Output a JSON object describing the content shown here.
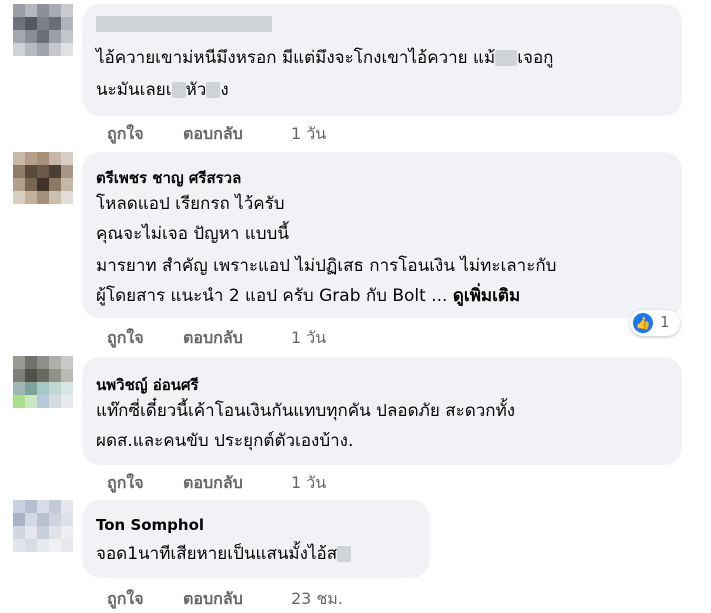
{
  "comments": [
    {
      "author": "",
      "lines": [
        "ไอ้ควายเขาม่หนีมึงหรอก มีแต่มึงจะโกงเขาไอ้ควาย แม้",
        "นะมันเลยเ"
      ],
      "line_tails": [
        "เจอกู",
        "หัว",
        "ง"
      ],
      "actions": {
        "like": "ถูกใจ",
        "reply": "ตอบกลับ",
        "time": "1 วัน"
      }
    },
    {
      "author": "ตรีเพชร ชาญ ศรีสรวล",
      "lines": [
        "โหลดแอป เรียกรถ ไว้ครับ",
        "คุณจะไม่เจอ ปัญหา แบบนี้",
        "มารยาท สำคัญ เพราะแอป ไม่ปฏิเสธ การโอนเงิน ไม่ทะเลาะกับ",
        "ผู้โดยสาร แนะนำ 2 แอป ครับ Grab กับ Bolt ..."
      ],
      "see_more": "ดูเพิ่มเติม",
      "reaction_count": "1",
      "actions": {
        "like": "ถูกใจ",
        "reply": "ตอบกลับ",
        "time": "1 วัน"
      }
    },
    {
      "author": "นพวิชญ์ อ่อนศรี",
      "lines": [
        "แท๊กซี่เดี๋ยวนี้เค้าโอนเงินกันแทบทุกคัน ปลอดภัย สะดวกทั้ง",
        "ผดส.และคนขับ ประยุกต์ตัวเองบ้าง."
      ],
      "actions": {
        "like": "ถูกใจ",
        "reply": "ตอบกลับ",
        "time": "1 วัน"
      }
    },
    {
      "author": "Ton Somphol",
      "lines": [
        "จอด1นาทีเสียหายเป็นแสนมั้งไอ้ส"
      ],
      "actions": {
        "like": "ถูกใจ",
        "reply": "ตอบกลับ",
        "time": "23 ชม."
      }
    }
  ],
  "colors": {
    "bubble": "#f0f2f5",
    "secondary_text": "#65676b",
    "like_blue": "#1877f2"
  },
  "icons": {
    "reaction": "like-thumbs-up-icon"
  }
}
